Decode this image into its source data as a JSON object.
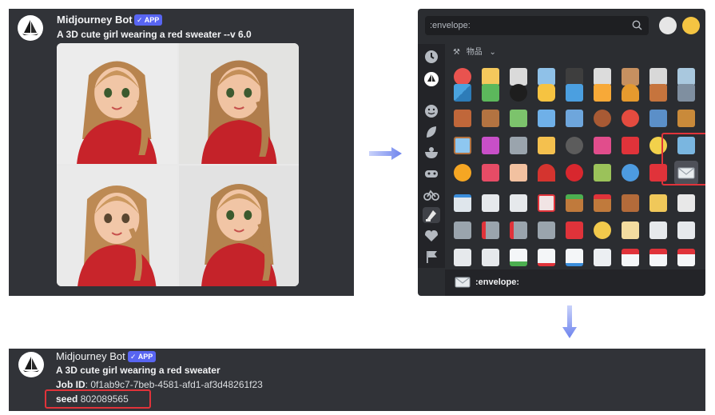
{
  "top_message": {
    "username": "Midjourney Bot",
    "badge": "✓ APP",
    "prompt": "A 3D cute girl wearing a red sweater --v 6.0"
  },
  "emoji_picker": {
    "search_placeholder": ":envelope:",
    "category_label": "物品",
    "footer_label": ":envelope:",
    "selected_emoji": "envelope"
  },
  "bottom_message": {
    "username": "Midjourney Bot",
    "badge": "✓ APP",
    "prompt": "A 3D cute girl wearing a red sweater",
    "job_id_label": "Job ID",
    "job_id_value": ": 0f1ab9c7-7beb-4581-afd1-af3d48261f23",
    "seed_label": "seed",
    "seed_value": " 802089565"
  },
  "colors": {
    "highlight": "#e0333a",
    "badge": "#5865f2",
    "arrow": "#7b8ff0",
    "panel": "#313338"
  }
}
